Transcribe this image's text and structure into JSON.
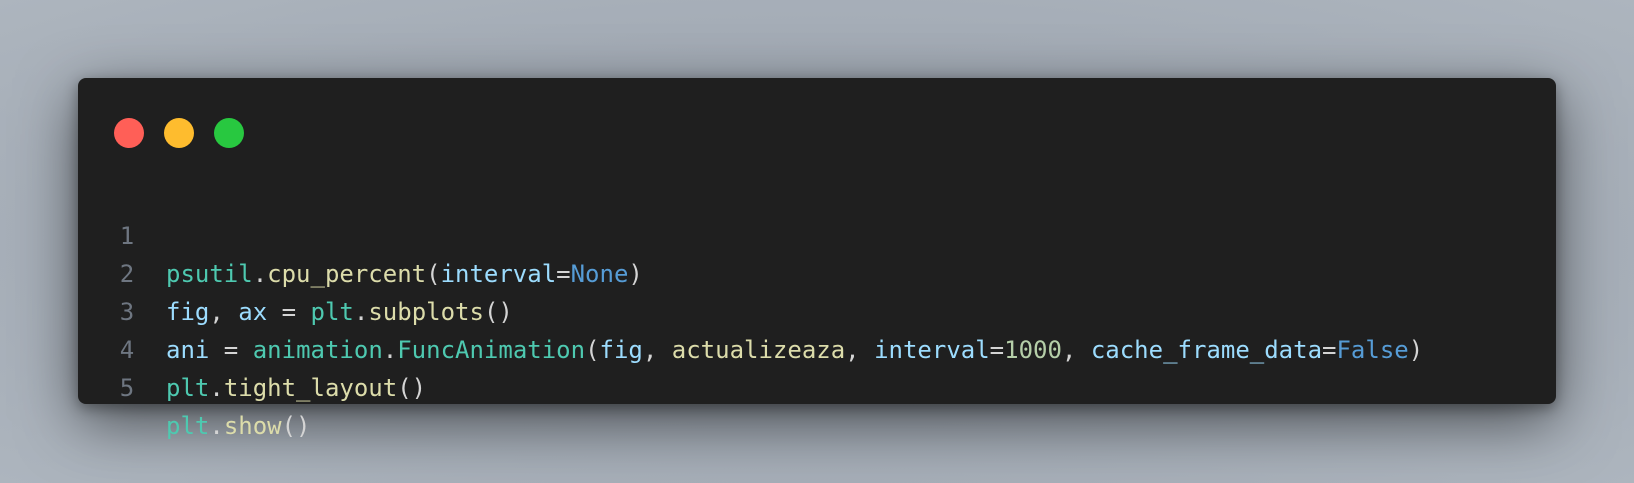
{
  "colors": {
    "red": "#ff5f57",
    "yellow": "#febc2e",
    "green": "#28c840",
    "module": "#4ec9b0",
    "function": "#dcdcaa",
    "variable": "#9cdcfe",
    "constant": "#569cd6",
    "number": "#b5cea8"
  },
  "window": {
    "controls": [
      "close",
      "minimize",
      "maximize"
    ]
  },
  "code": {
    "lines": [
      {
        "number": "1",
        "tokens": [
          {
            "text": "psutil",
            "kind": "mod"
          },
          {
            "text": ".",
            "kind": "p"
          },
          {
            "text": "cpu_percent",
            "kind": "fn"
          },
          {
            "text": "(",
            "kind": "p"
          },
          {
            "text": "interval",
            "kind": "var"
          },
          {
            "text": "=",
            "kind": "p"
          },
          {
            "text": "None",
            "kind": "kw"
          },
          {
            "text": ")",
            "kind": "p"
          }
        ]
      },
      {
        "number": "2",
        "tokens": [
          {
            "text": "fig",
            "kind": "var"
          },
          {
            "text": ", ",
            "kind": "p"
          },
          {
            "text": "ax",
            "kind": "var"
          },
          {
            "text": " = ",
            "kind": "p"
          },
          {
            "text": "plt",
            "kind": "mod"
          },
          {
            "text": ".",
            "kind": "p"
          },
          {
            "text": "subplots",
            "kind": "fn"
          },
          {
            "text": "()",
            "kind": "p"
          }
        ]
      },
      {
        "number": "3",
        "tokens": [
          {
            "text": "ani",
            "kind": "var"
          },
          {
            "text": " = ",
            "kind": "p"
          },
          {
            "text": "animation",
            "kind": "mod"
          },
          {
            "text": ".",
            "kind": "p"
          },
          {
            "text": "FuncAnimation",
            "kind": "mod"
          },
          {
            "text": "(",
            "kind": "p"
          },
          {
            "text": "fig",
            "kind": "var"
          },
          {
            "text": ", ",
            "kind": "p"
          },
          {
            "text": "actualizeaza",
            "kind": "fn"
          },
          {
            "text": ", ",
            "kind": "p"
          },
          {
            "text": "interval",
            "kind": "var"
          },
          {
            "text": "=",
            "kind": "p"
          },
          {
            "text": "1000",
            "kind": "num"
          },
          {
            "text": ", ",
            "kind": "p"
          },
          {
            "text": "cache_frame_data",
            "kind": "var"
          },
          {
            "text": "=",
            "kind": "p"
          },
          {
            "text": "False",
            "kind": "kw"
          },
          {
            "text": ")",
            "kind": "p"
          }
        ]
      },
      {
        "number": "4",
        "tokens": [
          {
            "text": "plt",
            "kind": "mod"
          },
          {
            "text": ".",
            "kind": "p"
          },
          {
            "text": "tight_layout",
            "kind": "fn"
          },
          {
            "text": "()",
            "kind": "p"
          }
        ]
      },
      {
        "number": "5",
        "tokens": [
          {
            "text": "plt",
            "kind": "mod"
          },
          {
            "text": ".",
            "kind": "p"
          },
          {
            "text": "show",
            "kind": "fn"
          },
          {
            "text": "()",
            "kind": "p"
          }
        ]
      }
    ]
  }
}
